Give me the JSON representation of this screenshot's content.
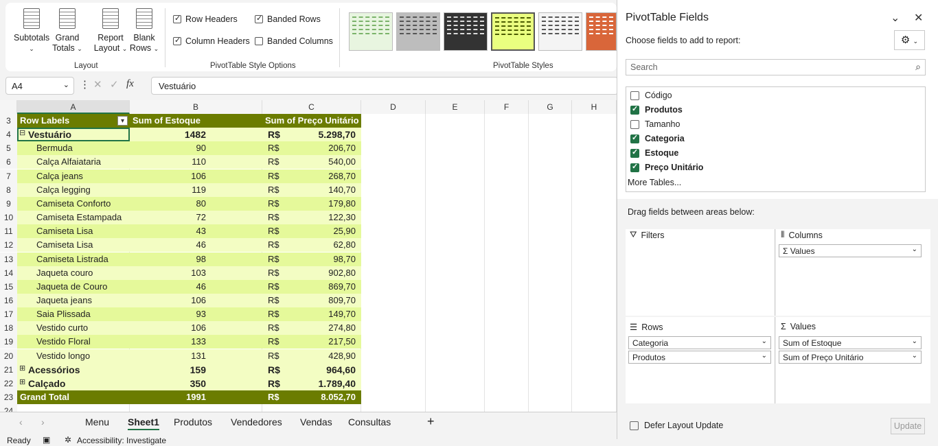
{
  "ribbon": {
    "layout_group": {
      "subtotals": "Subtotals",
      "grand_totals_1": "Grand",
      "grand_totals_2": "Totals",
      "report_layout_1": "Report",
      "report_layout_2": "Layout",
      "blank_rows_1": "Blank",
      "blank_rows_2": "Rows",
      "label": "Layout"
    },
    "style_options": {
      "row_headers": "Row Headers",
      "column_headers": "Column Headers",
      "banded_rows": "Banded Rows",
      "banded_columns": "Banded Columns",
      "label": "PivotTable Style Options"
    },
    "styles_label": "PivotTable Styles"
  },
  "formula_bar": {
    "name_box": "A4",
    "fx": "fx",
    "value": "Vestuário"
  },
  "columns": [
    "A",
    "B",
    "C",
    "D",
    "E",
    "F",
    "G",
    "H"
  ],
  "pivot": {
    "header": {
      "row_labels": "Row Labels",
      "sum_estoque": "Sum of Estoque",
      "sum_preco": "Sum of Preço Unitário"
    },
    "rows": [
      {
        "n": "4",
        "label": "Vestuário",
        "estoque": "1482",
        "cur": "R$",
        "preco": "5.298,70",
        "kind": "group"
      },
      {
        "n": "5",
        "label": "Bermuda",
        "estoque": "90",
        "cur": "R$",
        "preco": "206,70",
        "kind": "item"
      },
      {
        "n": "6",
        "label": "Calça Alfaiataria",
        "estoque": "110",
        "cur": "R$",
        "preco": "540,00",
        "kind": "item"
      },
      {
        "n": "7",
        "label": "Calça jeans",
        "estoque": "106",
        "cur": "R$",
        "preco": "268,70",
        "kind": "item"
      },
      {
        "n": "8",
        "label": "Calça legging",
        "estoque": "119",
        "cur": "R$",
        "preco": "140,70",
        "kind": "item"
      },
      {
        "n": "9",
        "label": "Camiseta Conforto",
        "estoque": "80",
        "cur": "R$",
        "preco": "179,80",
        "kind": "item"
      },
      {
        "n": "10",
        "label": "Camiseta Estampada",
        "estoque": "72",
        "cur": "R$",
        "preco": "122,30",
        "kind": "item"
      },
      {
        "n": "11",
        "label": "Camiseta Lisa",
        "estoque": "43",
        "cur": "R$",
        "preco": "25,90",
        "kind": "item"
      },
      {
        "n": "12",
        "label": "Camiseta Lisa",
        "estoque": "46",
        "cur": "R$",
        "preco": "62,80",
        "kind": "item"
      },
      {
        "n": "13",
        "label": "Camiseta Listrada",
        "estoque": "98",
        "cur": "R$",
        "preco": "98,70",
        "kind": "item"
      },
      {
        "n": "14",
        "label": "Jaqueta couro",
        "estoque": "103",
        "cur": "R$",
        "preco": "902,80",
        "kind": "item"
      },
      {
        "n": "15",
        "label": "Jaqueta de Couro",
        "estoque": "46",
        "cur": "R$",
        "preco": "869,70",
        "kind": "item"
      },
      {
        "n": "16",
        "label": "Jaqueta jeans",
        "estoque": "106",
        "cur": "R$",
        "preco": "809,70",
        "kind": "item"
      },
      {
        "n": "17",
        "label": "Saia Plissada",
        "estoque": "93",
        "cur": "R$",
        "preco": "149,70",
        "kind": "item"
      },
      {
        "n": "18",
        "label": "Vestido curto",
        "estoque": "106",
        "cur": "R$",
        "preco": "274,80",
        "kind": "item"
      },
      {
        "n": "19",
        "label": "Vestido Floral",
        "estoque": "133",
        "cur": "R$",
        "preco": "217,50",
        "kind": "item"
      },
      {
        "n": "20",
        "label": "Vestido longo",
        "estoque": "131",
        "cur": "R$",
        "preco": "428,90",
        "kind": "item"
      },
      {
        "n": "21",
        "label": "Acessórios",
        "estoque": "159",
        "cur": "R$",
        "preco": "964,60",
        "kind": "group-collapsed"
      },
      {
        "n": "22",
        "label": "Calçado",
        "estoque": "350",
        "cur": "R$",
        "preco": "1.789,40",
        "kind": "group-collapsed"
      },
      {
        "n": "23",
        "label": "Grand Total",
        "estoque": "1991",
        "cur": "R$",
        "preco": "8.052,70",
        "kind": "total"
      }
    ]
  },
  "sheet_tabs": [
    "Menu",
    "Sheet1",
    "Produtos",
    "Vendedores",
    "Vendas",
    "Consultas"
  ],
  "active_tab": "Sheet1",
  "status": {
    "ready": "Ready",
    "accessibility": "Accessibility: Investigate"
  },
  "pane": {
    "title": "PivotTable Fields",
    "choose": "Choose fields to add to report:",
    "search_placeholder": "Search",
    "fields": [
      {
        "name": "Código",
        "checked": false
      },
      {
        "name": "Produtos",
        "checked": true
      },
      {
        "name": "Tamanho",
        "checked": false
      },
      {
        "name": "Categoria",
        "checked": true
      },
      {
        "name": "Estoque",
        "checked": true
      },
      {
        "name": "Preço Unitário",
        "checked": true
      }
    ],
    "more_tables": "More Tables...",
    "drag_hint": "Drag fields between areas below:",
    "filters": "Filters",
    "columns": "Columns",
    "rows": "Rows",
    "values": "Values",
    "columns_items": [
      "Values"
    ],
    "rows_items": [
      "Categoria",
      "Produtos"
    ],
    "values_items": [
      "Sum of Estoque",
      "Sum of Preço Unitário"
    ],
    "defer": "Defer Layout Update",
    "update": "Update"
  },
  "colors": {
    "header_olive": "#6b7c00",
    "band_light": "#f3fdc3",
    "band_mid": "#e5f99a",
    "accent": "#217346"
  }
}
